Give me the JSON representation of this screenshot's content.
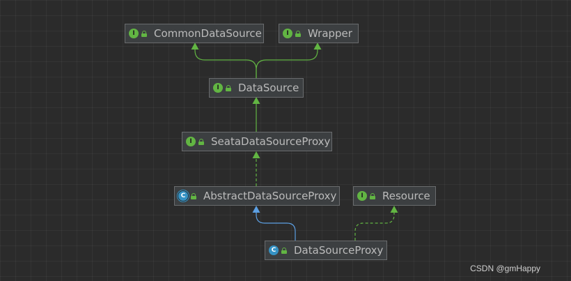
{
  "diagram": {
    "colors": {
      "background": "#2b2b2b",
      "interface_icon": "#62b543",
      "class_icon": "#3592c4",
      "implements_edge": "#62b543",
      "extends_edge": "#5c9fe2",
      "node_fill": "#3c3f41",
      "node_border": "#6a6c6e",
      "text": "#bbbbbb"
    },
    "nodes": {
      "common_data_source": {
        "label": "CommonDataSource",
        "kind": "interface",
        "kind_letter": "I",
        "visibility": "public"
      },
      "wrapper": {
        "label": "Wrapper",
        "kind": "interface",
        "kind_letter": "I",
        "visibility": "public"
      },
      "data_source": {
        "label": "DataSource",
        "kind": "interface",
        "kind_letter": "I",
        "visibility": "public"
      },
      "seata_data_source_proxy": {
        "label": "SeataDataSourceProxy",
        "kind": "interface",
        "kind_letter": "I",
        "visibility": "public"
      },
      "abstract_data_source_proxy": {
        "label": "AbstractDataSourceProxy",
        "kind": "abstract-class",
        "kind_letter": "C",
        "visibility": "public"
      },
      "resource": {
        "label": "Resource",
        "kind": "interface",
        "kind_letter": "I",
        "visibility": "public"
      },
      "data_source_proxy": {
        "label": "DataSourceProxy",
        "kind": "class",
        "kind_letter": "C",
        "visibility": "public"
      }
    },
    "edges": [
      {
        "from": "DataSource",
        "to": "CommonDataSource",
        "relation": "extends",
        "style": "solid",
        "color": "green"
      },
      {
        "from": "DataSource",
        "to": "Wrapper",
        "relation": "extends",
        "style": "solid",
        "color": "green"
      },
      {
        "from": "SeataDataSourceProxy",
        "to": "DataSource",
        "relation": "extends",
        "style": "solid",
        "color": "green"
      },
      {
        "from": "AbstractDataSourceProxy",
        "to": "SeataDataSourceProxy",
        "relation": "implements",
        "style": "dashed",
        "color": "green"
      },
      {
        "from": "DataSourceProxy",
        "to": "AbstractDataSourceProxy",
        "relation": "extends",
        "style": "solid",
        "color": "blue"
      },
      {
        "from": "DataSourceProxy",
        "to": "Resource",
        "relation": "implements",
        "style": "dashed",
        "color": "green"
      }
    ]
  },
  "watermark": "CSDN @gmHappy"
}
